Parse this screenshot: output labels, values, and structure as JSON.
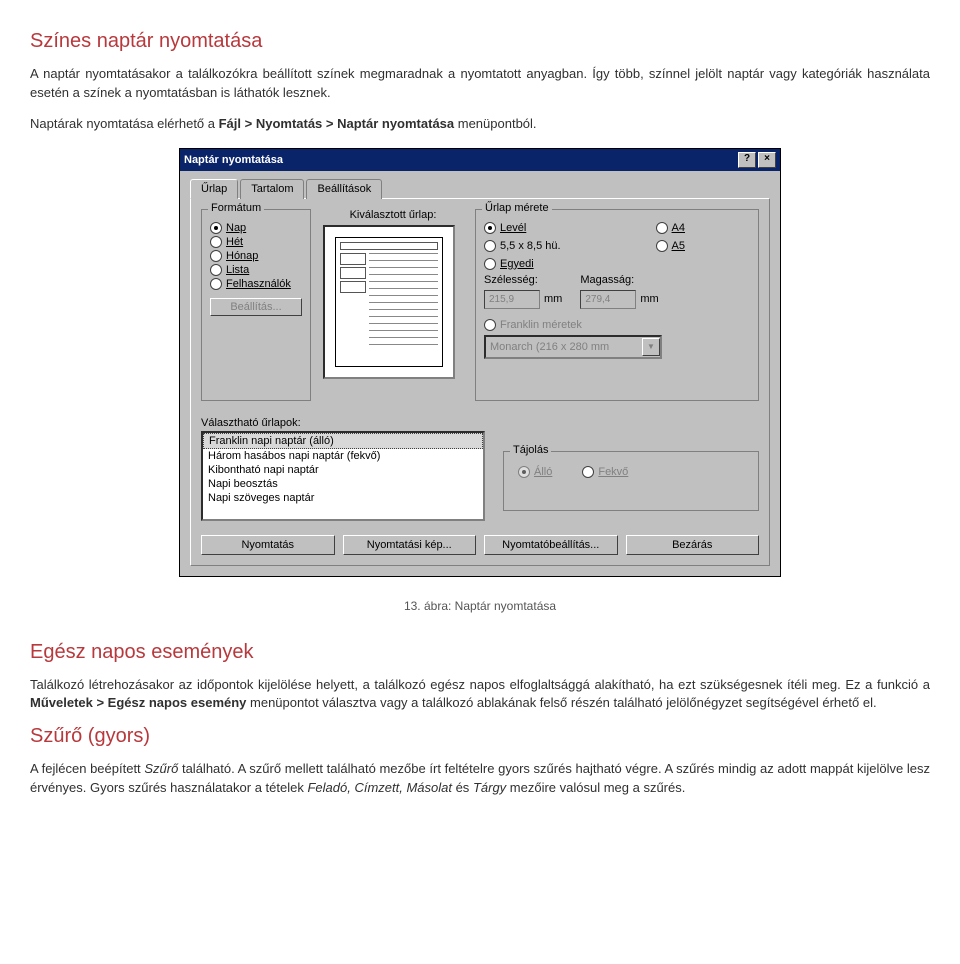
{
  "section1": {
    "title": "Színes naptár nyomtatása",
    "p1a": "A naptár nyomtatásakor a találkozókra beállított színek megmaradnak a nyomtatott anyagban. Így több, színnel jelölt naptár vagy kategóriák használata esetén a színek a nyomtatásban is láthatók lesznek.",
    "p2a": "Naptárak nyomtatása elérhető a ",
    "p2b": "Fájl > Nyomtatás > Naptár nyomtatása",
    "p2c": " menüpontból."
  },
  "dialog": {
    "title": "Naptár nyomtatása",
    "help": "?",
    "close": "×",
    "tabs": {
      "t1": "Űrlap",
      "t2": "Tartalom",
      "t3": "Beállítások"
    },
    "formatGroup": "Formátum",
    "format": {
      "nap": "Nap",
      "het": "Hét",
      "honap": "Hónap",
      "lista": "Lista",
      "felhasznalok": "Felhasználók"
    },
    "beallitasBtn": "Beállítás...",
    "previewLabel": "Kiválasztott űrlap:",
    "sizeGroup": "Űrlap mérete",
    "size": {
      "level": "Levél",
      "a4": "A4",
      "hu": "5,5 x 8,5 hü.",
      "a5": "A5",
      "egyedi": "Egyedi",
      "szLabel": "Szélesség:",
      "mLabel": "Magasság:",
      "szVal": "215,9",
      "mVal": "279,4",
      "mm": "mm",
      "franklin": "Franklin méretek",
      "comboVal": "Monarch  (216 x 280 mm"
    },
    "formListLabel": "Választható űrlapok:",
    "formList": [
      "Franklin napi naptár (álló)",
      "Három hasábos napi naptár (fekvő)",
      "Kibontható napi naptár",
      "Napi beosztás",
      "Napi szöveges naptár"
    ],
    "orientGroup": "Tájolás",
    "orient": {
      "allo": "Álló",
      "fekvo": "Fekvő"
    },
    "buttons": {
      "nyomtatas": "Nyomtatás",
      "kep": "Nyomtatási kép...",
      "beall": "Nyomtatóbeállítás...",
      "bezar": "Bezárás"
    }
  },
  "caption": "13. ábra: Naptár nyomtatása",
  "section2": {
    "title": "Egész napos események",
    "p1a": "Találkozó létrehozásakor az időpontok kijelölése helyett, a találkozó egész napos elfoglaltsággá alakítható, ha ezt szükségesnek ítéli meg. Ez a funkció a ",
    "p1b": "Műveletek > Egész napos esemény",
    "p1c": " menüpontot választva vagy a találkozó ablakának felső részén található jelölőnégyzet segítségével érhető el."
  },
  "section3": {
    "title": "Szűrő (gyors)",
    "p1a": "A fejlécen beépített ",
    "p1b": "Szűrő",
    "p1c": " található. A szűrő mellett található mezőbe írt feltételre gyors szűrés hajtható végre. A szűrés mindig az adott mappát kijelölve lesz érvényes. Gyors szűrés használatakor a tételek ",
    "p1d": "Feladó, Címzett, Másolat",
    "p1e": " és ",
    "p1f": "Tárgy",
    "p1g": " mezőire valósul meg a szűrés."
  }
}
